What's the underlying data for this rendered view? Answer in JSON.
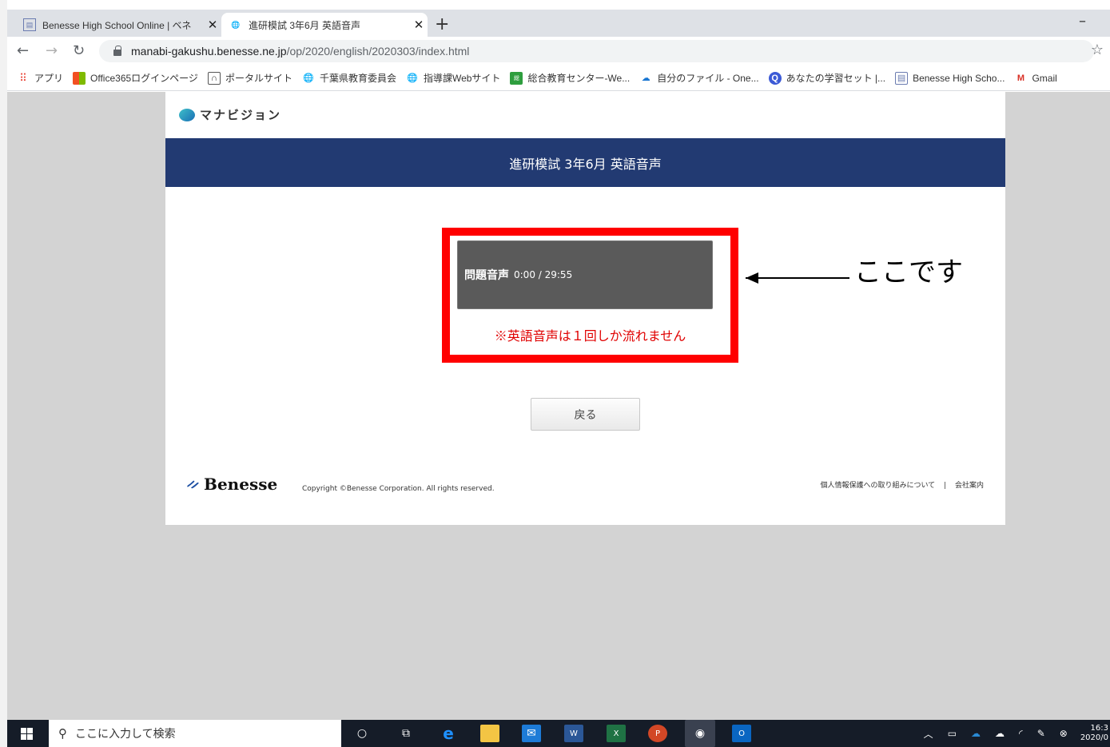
{
  "browser": {
    "tabs": [
      {
        "title": "Benesse High School Online | ベネ",
        "active": false
      },
      {
        "title": "進研模試 3年6月 英語音声",
        "active": true
      }
    ],
    "new_tab": "+",
    "minimize": "–",
    "url_host": "manabi-gakushu.benesse.ne.jp",
    "url_path": "/op/2020/english/2020303/index.html",
    "bookmarks": [
      {
        "label": "アプリ",
        "icon": "apps-grid-icon",
        "color": "#ea4335"
      },
      {
        "label": "Office365ログインページ",
        "icon": "office-icon",
        "color": "#f25022"
      },
      {
        "label": "ポータルサイト",
        "icon": "portal-icon",
        "color": "#555555"
      },
      {
        "label": "千葉県教育委員会",
        "icon": "globe-icon",
        "color": "#333333"
      },
      {
        "label": "指導課Webサイト",
        "icon": "globe-icon",
        "color": "#333333"
      },
      {
        "label": "総合教育センター-We...",
        "icon": "edu-center-icon",
        "color": "#2e9e3e"
      },
      {
        "label": "自分のファイル - One...",
        "icon": "onedrive-icon",
        "color": "#1976d2"
      },
      {
        "label": "あなたの学習セット |...",
        "icon": "quizlet-icon",
        "color": "#3c5ad6"
      },
      {
        "label": "Benesse High Scho...",
        "icon": "benesse-icon",
        "color": "#6a7bb0"
      },
      {
        "label": "Gmail",
        "icon": "gmail-icon",
        "color": "#d93025"
      }
    ]
  },
  "page": {
    "logo_text": "マナビジョン",
    "header_title": "進研模試 3年6月 英語音声",
    "player": {
      "label": "問題音声",
      "time": "0:00 / 29:55"
    },
    "warning": "※英語音声は１回しか流れません",
    "annotation": "ここです",
    "back_button": "戻る",
    "footer": {
      "brand": "Benesse",
      "copyright": "Copyright ©Benesse Corporation. All rights reserved.",
      "privacy_link": "個人情報保護への取り組みについて",
      "separator": "|",
      "company_link": "会社案内"
    }
  },
  "taskbar": {
    "search_placeholder": "ここに入力して検索",
    "clock_time": "16:3",
    "clock_date": "2020/0"
  },
  "colors": {
    "header_band": "#223a72",
    "highlight_border": "#ff0000",
    "warning_text": "#e00000",
    "player_bg": "#5a5a5a"
  }
}
